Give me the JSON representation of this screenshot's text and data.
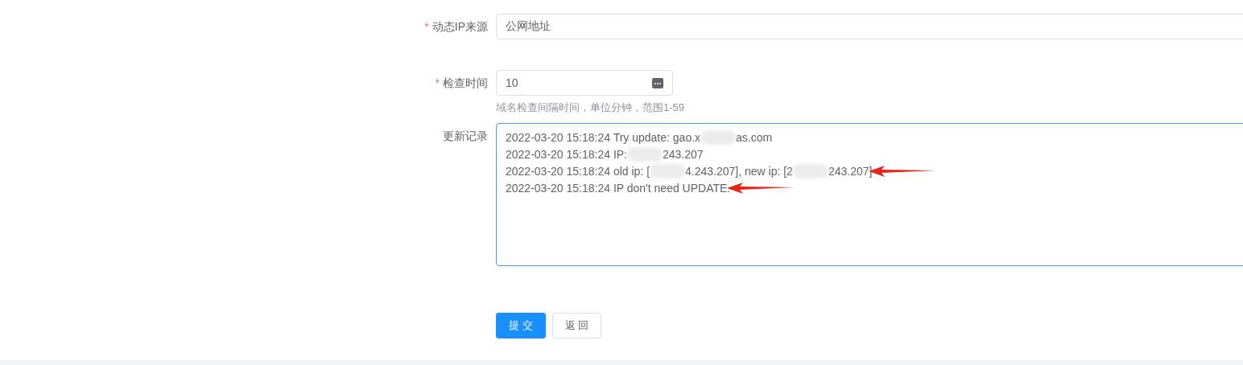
{
  "form": {
    "fields": [
      {
        "kind": "text",
        "label": "动态IP来源",
        "required_mark": "*",
        "value": "公网地址"
      },
      {
        "kind": "number",
        "label": "检查时间",
        "required_mark": "*",
        "value": "10",
        "hint": "域名检查间隔时间，单位分钟，范围1-59"
      },
      {
        "kind": "log",
        "label": "更新记录",
        "lines": [
          {
            "arrow": false,
            "parts": [
              {
                "kind": "text",
                "text": "2022-03-20 15:18:24 Try update: gao.x"
              },
              {
                "kind": "redacted"
              },
              {
                "kind": "text",
                "text": "as.com"
              }
            ]
          },
          {
            "arrow": false,
            "parts": [
              {
                "kind": "text",
                "text": "2022-03-20 15:18:24 IP:"
              },
              {
                "kind": "redacted"
              },
              {
                "kind": "text",
                "text": "243.207"
              }
            ]
          },
          {
            "arrow": true,
            "parts": [
              {
                "kind": "text",
                "text": "2022-03-20 15:18:24 old ip: ["
              },
              {
                "kind": "redacted"
              },
              {
                "kind": "text",
                "text": "4.243.207], new ip: [2"
              },
              {
                "kind": "redacted"
              },
              {
                "kind": "text",
                "text": "243.207]"
              }
            ]
          },
          {
            "arrow": true,
            "parts": [
              {
                "kind": "text",
                "text": "2022-03-20 15:18:24 IP don't need UPDATE."
              }
            ]
          }
        ]
      }
    ]
  },
  "buttons": [
    {
      "kind": "primary",
      "label": "提 交"
    },
    {
      "kind": "default",
      "label": "返 回"
    }
  ]
}
